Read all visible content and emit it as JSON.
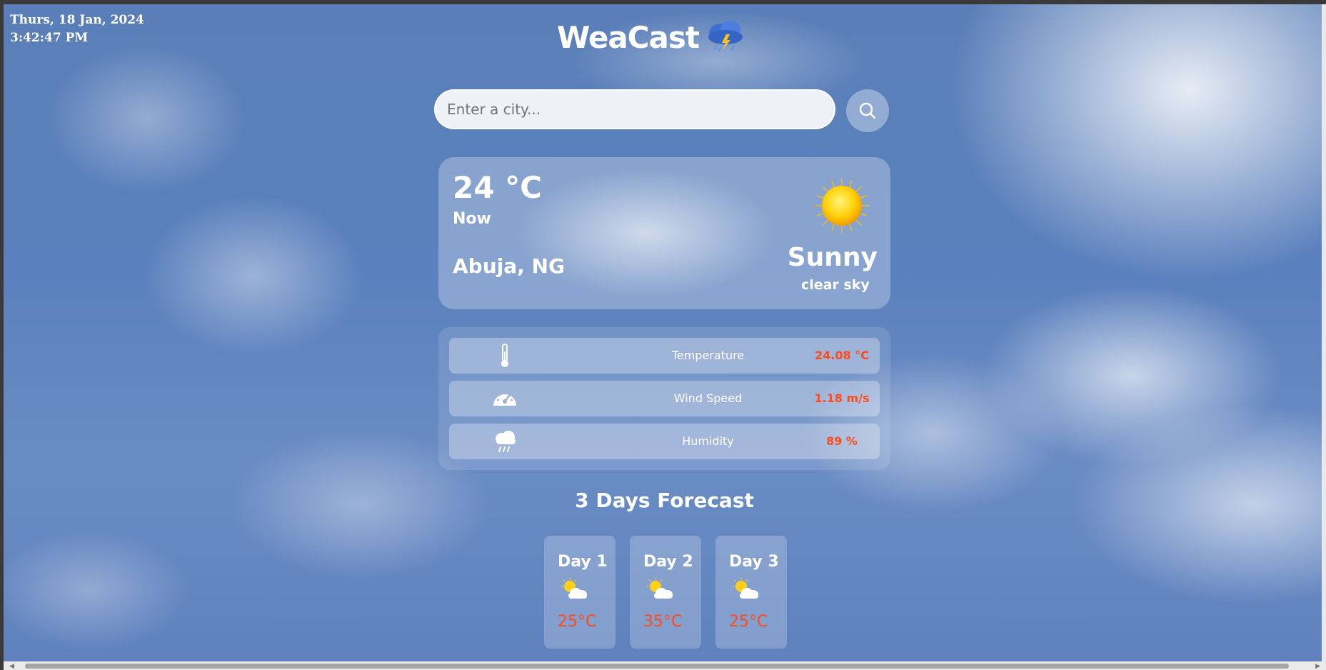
{
  "clock": {
    "date": "Thurs, 18 Jan, 2024",
    "time": "3:42:47 PM"
  },
  "header": {
    "title": "WeaCast",
    "icon": "storm-cloud-icon"
  },
  "search": {
    "placeholder": "Enter a city...",
    "value": "",
    "button_icon": "search-icon"
  },
  "current": {
    "temperature": "24 °C",
    "time_label": "Now",
    "location": "Abuja, NG",
    "condition": "Sunny",
    "description": "clear sky",
    "icon": "sun-icon"
  },
  "details": [
    {
      "icon": "thermometer-icon",
      "label": "Temperature",
      "value": "24.08 °C"
    },
    {
      "icon": "gauge-icon",
      "label": "Wind Speed",
      "value": "1.18 m/s"
    },
    {
      "icon": "rain-cloud-icon",
      "label": "Humidity",
      "value": "89 %"
    }
  ],
  "forecast": {
    "title": "3 Days Forecast",
    "days": [
      {
        "day": "Day 1",
        "temp": "25°C",
        "icon": "partly-cloudy-icon"
      },
      {
        "day": "Day 2",
        "temp": "35°C",
        "icon": "partly-cloudy-icon"
      },
      {
        "day": "Day 3",
        "temp": "25°C",
        "icon": "partly-cloudy-icon"
      }
    ]
  },
  "colors": {
    "accent": "#ff4a1a",
    "text": "#ffffff",
    "sky": "#5a80bd"
  }
}
